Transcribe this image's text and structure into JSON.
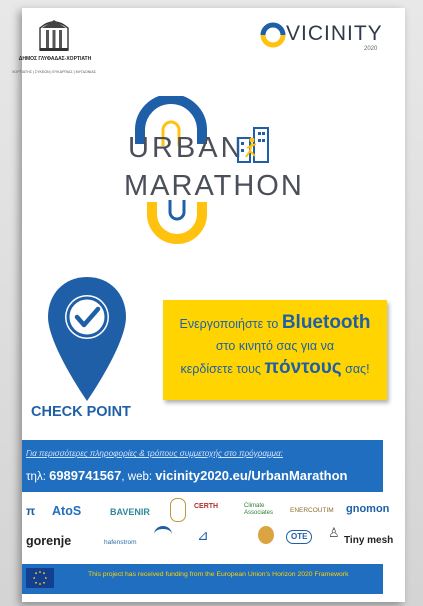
{
  "municipality": {
    "name": "ΔΗΜΟΣ ΓΛΥΦΑΔΑΣ-ΧΟΡΤΙΑΤΗ",
    "subtitle": "ΧΟΡΤΙΑΤΗΣ | ΣΥΚΕΩΝ | ΕΥΚΑΡΠΙΑΣ | ΜΥΓΔΟΝΙΑΣ"
  },
  "vicinity": {
    "name": "VICINITY",
    "year": "2020"
  },
  "urban_marathon": {
    "line1": "URBAN",
    "line2": "MARATHON"
  },
  "checkpoint": {
    "label": "CHECK POINT"
  },
  "callout": {
    "part1": "Ενεργοποιήστε το ",
    "bluetooth": "Bluetooth",
    "line2": "στο κινητό σας για να",
    "line3_pre": "κερδίσετε τους ",
    "points": "πόντους",
    "line3_post": " σας!"
  },
  "info": {
    "line1": "Για περισσότερες πληροφορίες & τρόπους συμμετοχής στο πρόγραμμα:",
    "phone_label": "τηλ: ",
    "phone": "6989741567",
    "web_label": ", web: ",
    "web": "vicinity2020.eu/UrbanMarathon"
  },
  "partners": {
    "row1": [
      "AtoS",
      "BAVENIR",
      "CERTH",
      "Climate Associates",
      "ENERCOUTIM",
      "gnomon"
    ],
    "row2": [
      "gorenje",
      "hafenstrom",
      "Tiny mesh"
    ],
    "row2_extra": [
      "OTE"
    ]
  },
  "eu": {
    "text": "This project has received funding from the European Union's Horizon 2020 Framework"
  },
  "colors": {
    "blue": "#1f5fa8",
    "yellow": "#ffd400",
    "gray_text": "#4a4f5a"
  }
}
